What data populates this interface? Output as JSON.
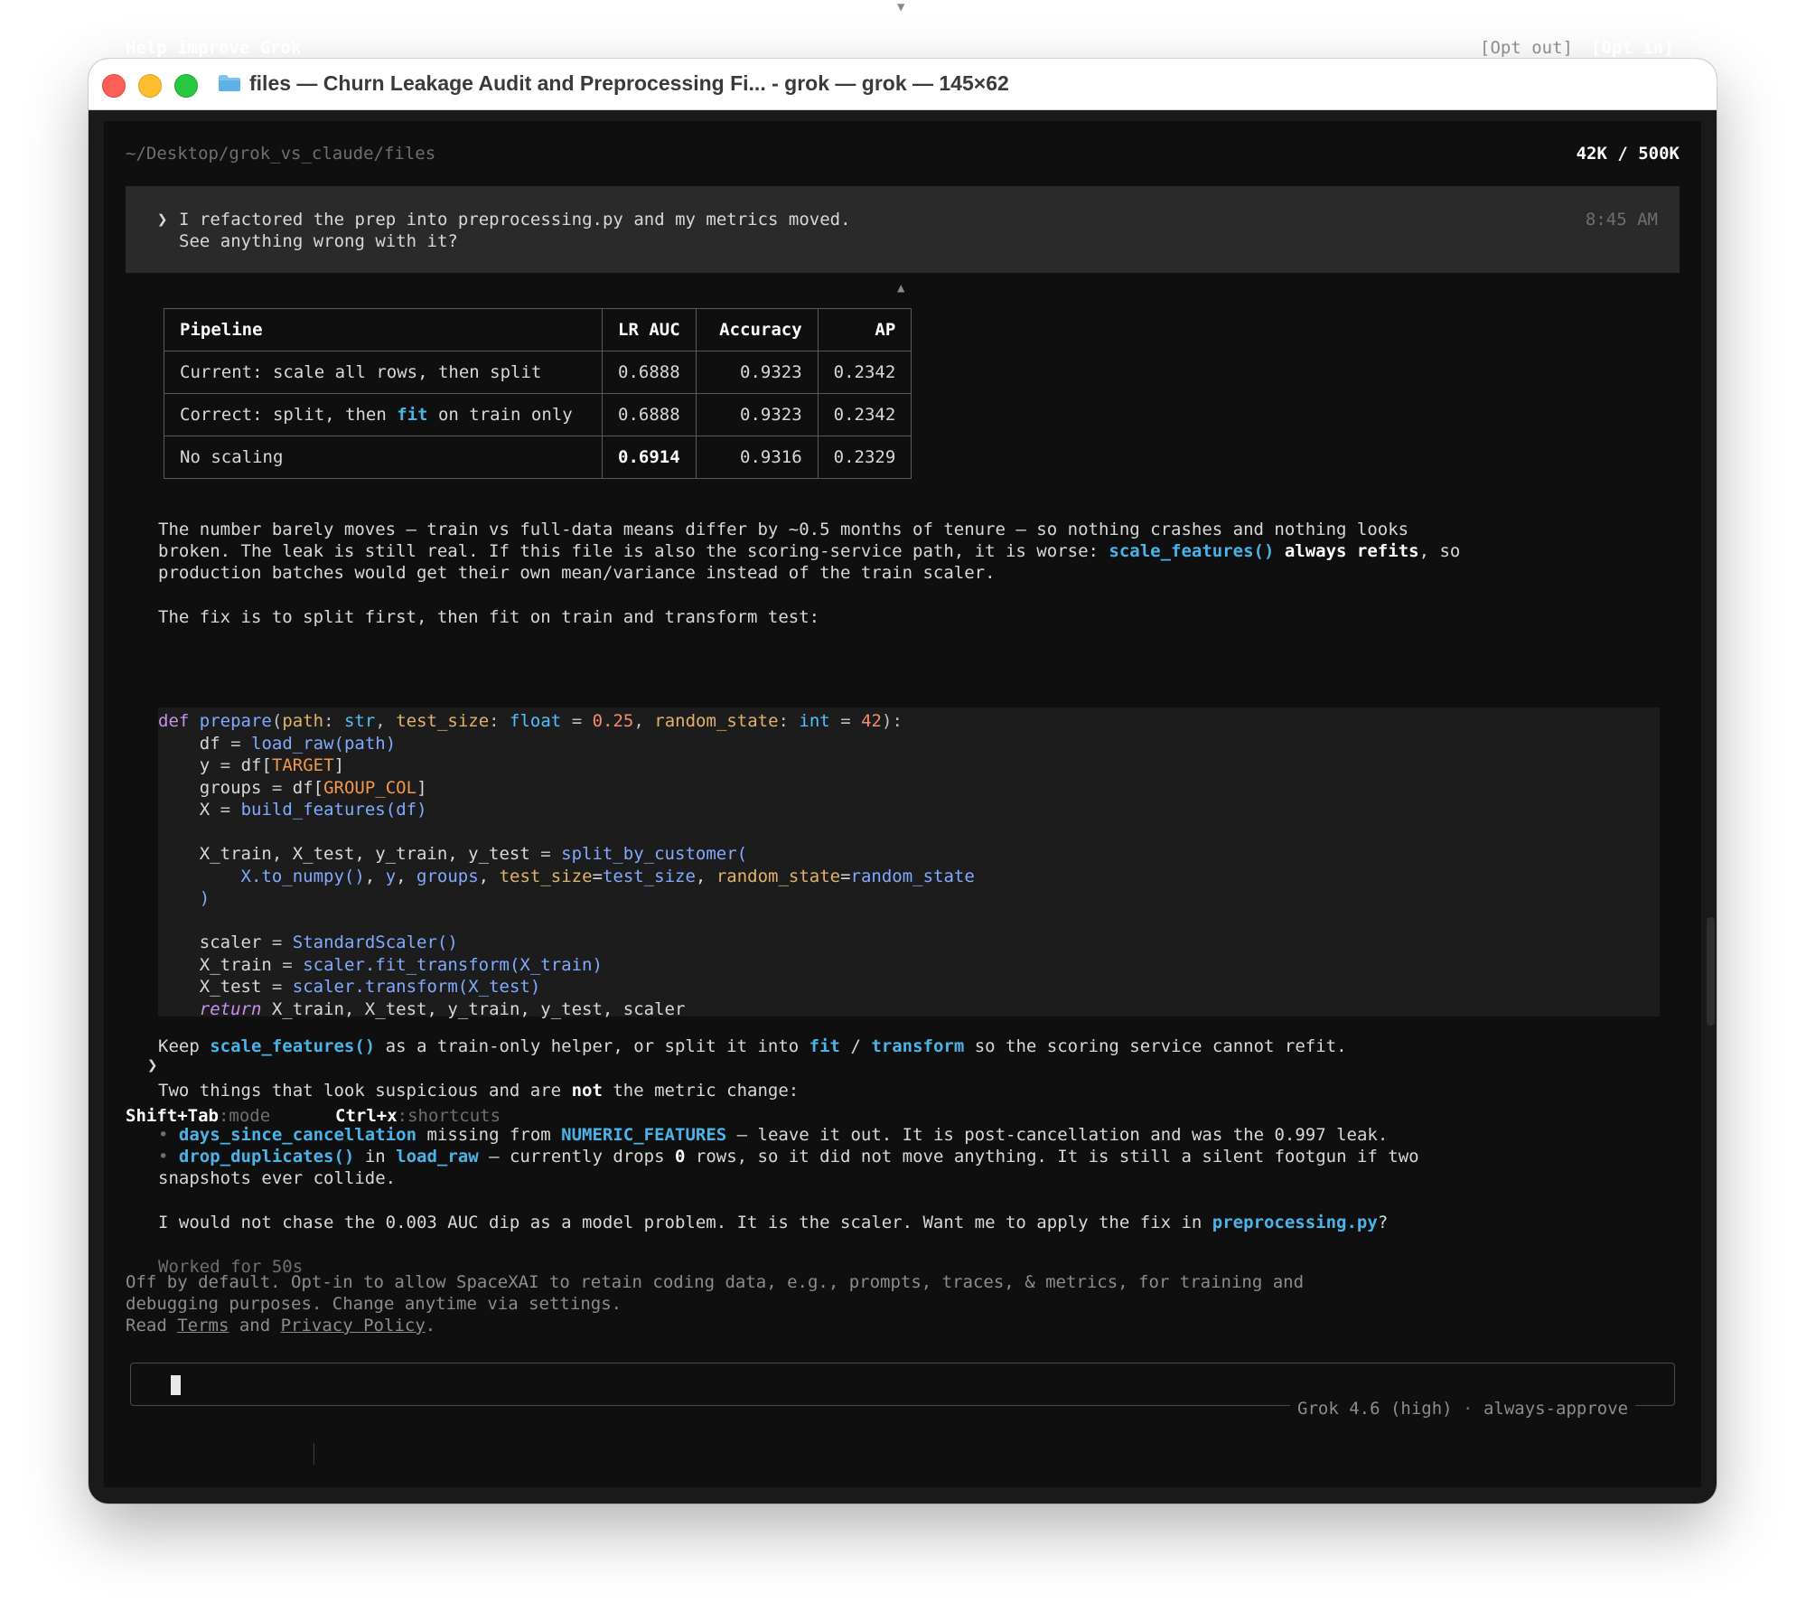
{
  "window": {
    "title": "files — Churn Leakage Audit and Preprocessing Fi... - grok — grok — 145×62"
  },
  "header": {
    "path": "~/Desktop/grok_vs_claude/files",
    "token_usage": "42K / 500K"
  },
  "user_message": {
    "prompt_glyph": "❯",
    "line1": "I refactored the prep into preprocessing.py and my metrics moved.",
    "line2": "See anything wrong with it?",
    "time": "8:45 AM"
  },
  "scroll": {
    "up": "▲",
    "down": "▼"
  },
  "results_table": {
    "headers": [
      "Pipeline",
      "LR AUC",
      "Accuracy",
      "AP"
    ],
    "rows": [
      {
        "pipeline_pre": "Current: scale all rows, then split",
        "pipeline_kw": "",
        "pipeline_post": "",
        "lr_auc": "0.6888",
        "accuracy": "0.9323",
        "ap": "0.2342"
      },
      {
        "pipeline_pre": "Correct: split, then ",
        "pipeline_kw": "fit",
        "pipeline_post": " on train only",
        "lr_auc": "0.6888",
        "accuracy": "0.9323",
        "ap": "0.2342"
      },
      {
        "pipeline_pre": "No scaling",
        "pipeline_kw": "",
        "pipeline_post": "",
        "lr_auc": "0.6914",
        "accuracy": "0.9316",
        "ap": "0.2329"
      }
    ]
  },
  "para1": {
    "line1": "The number barely moves — train vs full-data means differ by ~0.5 months of tenure — so nothing crashes and nothing looks",
    "line2_a": "broken. The leak is still real. If this file is also the scoring-service path, it is worse: ",
    "line2_code": "scale_features()",
    "line2_bold": " always refits",
    "line2_b": ", so",
    "line3": "production batches would get their own mean/variance instead of the train scaler."
  },
  "para2": "The fix is to split first, then fit on train and transform test:",
  "code": {
    "l1": {
      "def": "def",
      "name": "prepare",
      "p1": "path",
      "t1": "str",
      "p2": "test_size",
      "t2": "float",
      "v2": "0.25",
      "p3": "random_state",
      "t3": "int",
      "v3": "42"
    },
    "l2": {
      "var": "df",
      "fn": "load_raw",
      "arg": "path"
    },
    "l3": {
      "var": "y",
      "obj": "df",
      "key": "TARGET"
    },
    "l4": {
      "var": "groups",
      "obj": "df",
      "key": "GROUP_COL"
    },
    "l5": {
      "var": "X",
      "fn": "build_features",
      "arg": "df"
    },
    "l7": {
      "lhs": "X_train, X_test, y_train, y_test",
      "fn": "split_by_customer"
    },
    "l8": {
      "a1": "X.to_numpy()",
      "a2": "y",
      "a3": "groups",
      "k1": "test_size",
      "v1": "test_size",
      "k2": "random_state",
      "v2": "random_state"
    },
    "l9": {
      "close": ")"
    },
    "l11": {
      "var": "scaler",
      "fn": "StandardScaler()"
    },
    "l12": {
      "var": "X_train",
      "fn": "scaler.fit_transform(X_train)"
    },
    "l13": {
      "var": "X_test",
      "fn": "scaler.transform(X_test)"
    },
    "l14": {
      "kw": "return",
      "rest": "X_train, X_test, y_train, y_test, scaler"
    }
  },
  "para3": {
    "a": "Keep ",
    "c1": "scale_features()",
    "b": " as a train-only helper, or split it into ",
    "c2": "fit",
    "c": " / ",
    "c3": "transform",
    "d": " so the scoring service cannot refit."
  },
  "para4": {
    "a": "Two things that look suspicious and are ",
    "bold": "not",
    "b": " the metric change:"
  },
  "bullets": [
    {
      "dot": "•",
      "c1": "days_since_cancellation",
      "a": " missing from ",
      "c2": "NUMERIC_FEATURES",
      "b": " — leave it out. It is post-cancellation and was the 0.997 leak.",
      "cont": ""
    },
    {
      "dot": "•",
      "c1": "drop_duplicates()",
      "a": " in ",
      "c2": "load_raw",
      "b": " — currently drops ",
      "bold": "0",
      "b2": " rows, so it did not move anything. It is still a silent footgun if two",
      "cont": "snapshots ever collide."
    }
  ],
  "para5": {
    "a": "I would not chase the 0.003 AUC dip as a model problem. It is the scaler. Want me to apply the fix in ",
    "c": "preprocessing.py",
    "b": "?"
  },
  "worked": "Worked for 50s",
  "notice": {
    "title": "Help improve Grok",
    "opt_out": "[Opt out]",
    "opt_in": "[Opt in]",
    "line1": "Off by default. Opt-in to allow SpaceXAI to retain coding data, e.g., prompts, traces, & metrics, for training and",
    "line2": "debugging purposes. Change anytime via settings.",
    "read": "Read ",
    "terms": "Terms",
    "and": " and ",
    "privacy": "Privacy Policy",
    "period": "."
  },
  "input": {
    "prompt_glyph": "❯",
    "value": "",
    "model": "Grok 4.6 (high)",
    "dot": "·",
    "mode": "always-approve"
  },
  "footer": {
    "key1": "Shift+Tab",
    "val1": ":mode",
    "key2": "Ctrl+x",
    "val2": ":shortcuts"
  },
  "colors": {
    "accent": "#4ab3e8",
    "background": "#0f0f0f",
    "user_box": "#2a2a2a"
  }
}
